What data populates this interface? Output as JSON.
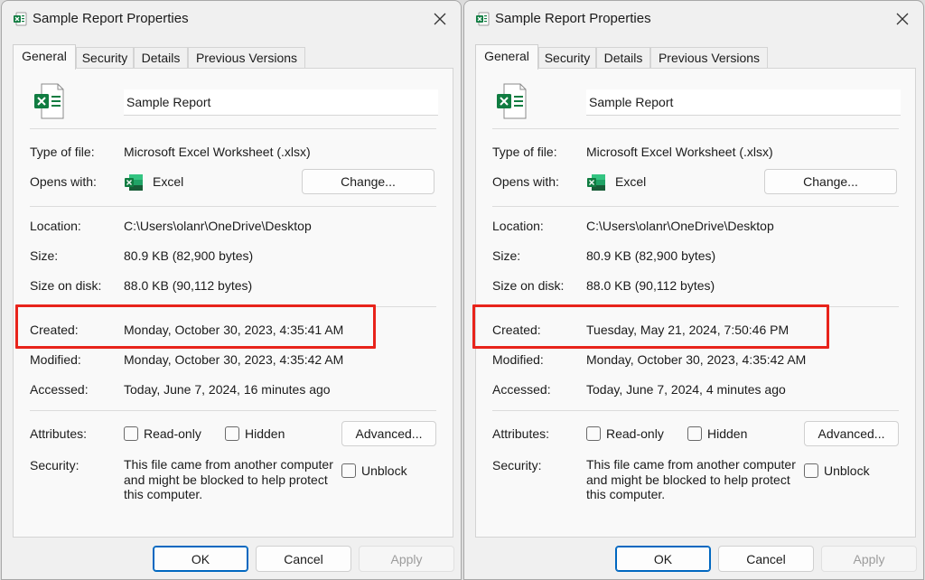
{
  "windows": [
    {
      "title": "Sample Report Properties",
      "tabs": [
        "General",
        "Security",
        "Details",
        "Previous Versions"
      ],
      "file_name": "Sample Report",
      "labels": {
        "type_of_file": "Type of file:",
        "opens_with": "Opens with:",
        "location": "Location:",
        "size": "Size:",
        "size_on_disk": "Size on disk:",
        "created": "Created:",
        "modified": "Modified:",
        "accessed": "Accessed:",
        "attributes": "Attributes:",
        "security": "Security:"
      },
      "values": {
        "type_of_file": "Microsoft Excel Worksheet (.xlsx)",
        "opens_with": "Excel",
        "location": "C:\\Users\\olanr\\OneDrive\\Desktop",
        "size": "80.9 KB (82,900 bytes)",
        "size_on_disk": "88.0 KB (90,112 bytes)",
        "created": "Monday, October 30, 2023, 4:35:41 AM",
        "modified": "Monday, October 30, 2023, 4:35:42 AM",
        "accessed": "Today, June 7, 2024, 16 minutes ago",
        "security_text": "This file came from another computer and might be blocked to help protect this computer."
      },
      "buttons": {
        "change": "Change...",
        "advanced": "Advanced...",
        "ok": "OK",
        "cancel": "Cancel",
        "apply": "Apply"
      },
      "checkboxes": {
        "read_only": "Read-only",
        "hidden": "Hidden",
        "unblock": "Unblock"
      }
    },
    {
      "title": "Sample Report Properties",
      "tabs": [
        "General",
        "Security",
        "Details",
        "Previous Versions"
      ],
      "file_name": "Sample Report",
      "labels": {
        "type_of_file": "Type of file:",
        "opens_with": "Opens with:",
        "location": "Location:",
        "size": "Size:",
        "size_on_disk": "Size on disk:",
        "created": "Created:",
        "modified": "Modified:",
        "accessed": "Accessed:",
        "attributes": "Attributes:",
        "security": "Security:"
      },
      "values": {
        "type_of_file": "Microsoft Excel Worksheet (.xlsx)",
        "opens_with": "Excel",
        "location": "C:\\Users\\olanr\\OneDrive\\Desktop",
        "size": "80.9 KB (82,900 bytes)",
        "size_on_disk": "88.0 KB (90,112 bytes)",
        "created": "Tuesday, May 21, 2024, 7:50:46 PM",
        "modified": "Monday, October 30, 2023, 4:35:42 AM",
        "accessed": "Today, June 7, 2024, 4 minutes ago",
        "security_text": "This file came from another computer and might be blocked to help protect this computer."
      },
      "buttons": {
        "change": "Change...",
        "advanced": "Advanced...",
        "ok": "OK",
        "cancel": "Cancel",
        "apply": "Apply"
      },
      "checkboxes": {
        "read_only": "Read-only",
        "hidden": "Hidden",
        "unblock": "Unblock"
      }
    }
  ],
  "colors": {
    "excel_green": "#107c41",
    "highlight_red": "#e8231b",
    "accent_blue": "#0067c0"
  },
  "icons": {
    "app": "excel-file-icon",
    "close": "close-icon"
  }
}
